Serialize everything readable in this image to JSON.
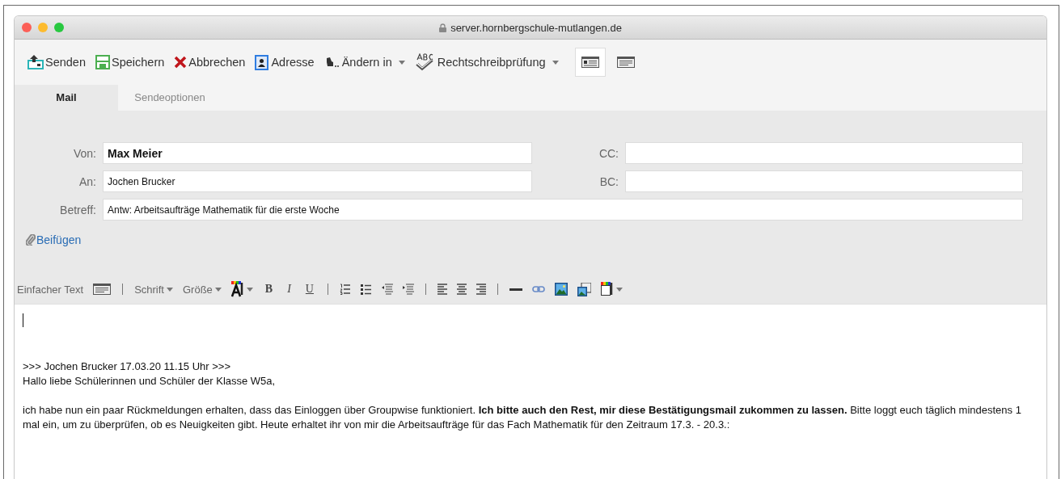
{
  "window": {
    "title": "server.hornbergschule-mutlangen.de"
  },
  "toolbar": [
    {
      "label": "Senden"
    },
    {
      "label": "Speichern"
    },
    {
      "label": "Abbrechen"
    },
    {
      "label": "Adresse"
    },
    {
      "label": "Ändern in"
    },
    {
      "label": "Rechtschreibprüfung"
    }
  ],
  "view_toggles": [
    {
      "selected": true
    },
    {
      "selected": false
    }
  ],
  "tabs": [
    {
      "label": "Mail",
      "selected": true
    },
    {
      "label": "Sendeoptionen",
      "selected": false
    }
  ],
  "address_fields": {
    "left": [
      {
        "label": "Von:",
        "value": "Max Meier"
      },
      {
        "label": "An:",
        "value": "Jochen Brucker"
      }
    ],
    "right": [
      {
        "label": "CC:"
      },
      {
        "label": "BC:"
      }
    ]
  },
  "subject": {
    "label": "Betreff:",
    "value": "Antw: Arbeitsaufträge Mathematik für die erste Woche"
  },
  "attach": {
    "label": "Beifügen"
  },
  "format_toolbar": [
    {
      "kind": "label",
      "text": "Einfacher Text"
    },
    {
      "kind": "icon"
    },
    {
      "kind": "separator"
    },
    {
      "kind": "menu",
      "text": "Schrift"
    },
    {
      "kind": "menu",
      "text": "Größe"
    },
    {
      "kind": "icon"
    },
    {
      "kind": "bold",
      "text": "B"
    },
    {
      "kind": "italic",
      "text": "I"
    },
    {
      "kind": "underline",
      "text": "U"
    },
    {
      "kind": "separator"
    },
    {
      "kind": "icon"
    },
    {
      "kind": "icon"
    },
    {
      "kind": "icon"
    },
    {
      "kind": "icon"
    },
    {
      "kind": "separator"
    },
    {
      "kind": "icon"
    },
    {
      "kind": "icon"
    },
    {
      "kind": "icon"
    },
    {
      "kind": "separator"
    },
    {
      "kind": "icon"
    },
    {
      "kind": "icon"
    },
    {
      "kind": "icon"
    },
    {
      "kind": "icon"
    },
    {
      "kind": "icon"
    }
  ],
  "body": [
    {
      "kind": "cursor"
    },
    {
      "kind": "blank"
    },
    {
      "kind": "text",
      "text": ">>> Jochen Brucker 17.03.20 11.15 Uhr >>>"
    },
    {
      "kind": "text",
      "text": "Hallo liebe Schülerinnen und Schüler der Klasse W5a,"
    },
    {
      "kind": "blank"
    },
    {
      "kind": "text",
      "text": "ich habe nun ein paar Rückmeldungen erhalten, dass das Einloggen über Groupwise funktioniert. **Ich bitte auch den Rest, mir diese Bestätigungsmail zukommen zu lassen.** Bitte loggt euch täglich mindestens 1 mal ein, um zu überprüfen, ob es Neuigkeiten gibt. Heute erhaltet ihr von mir die Arbeitsaufträge für das Fach Mathematik für den Zeitraum 17.3. - 20.3.:"
    }
  ]
}
